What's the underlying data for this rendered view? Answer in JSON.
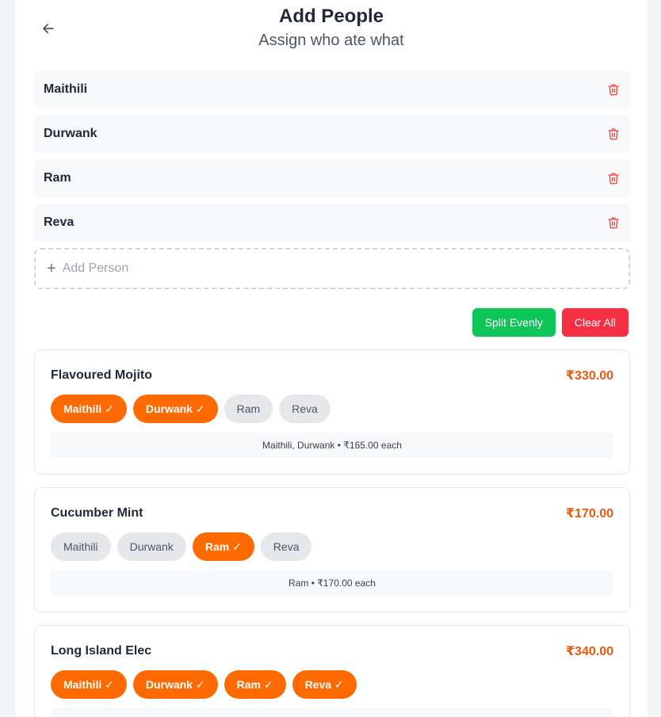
{
  "header": {
    "title": "Add People",
    "subtitle": "Assign who ate what",
    "back_icon": "arrow-left-icon"
  },
  "people": [
    {
      "name": "Maithili"
    },
    {
      "name": "Durwank"
    },
    {
      "name": "Ram"
    },
    {
      "name": "Reva"
    }
  ],
  "add_person": {
    "placeholder": "Add Person",
    "icon": "plus-icon"
  },
  "actions": {
    "split_label": "Split Evenly",
    "clear_label": "Clear All"
  },
  "items": [
    {
      "name": "Flavoured Mojito",
      "price": "₹330.00",
      "chips": [
        {
          "label": "Maithili ✓",
          "selected": true
        },
        {
          "label": "Durwank ✓",
          "selected": true
        },
        {
          "label": "Ram",
          "selected": false
        },
        {
          "label": "Reva",
          "selected": false
        }
      ],
      "summary": "Maithili, Durwank • ₹165.00 each"
    },
    {
      "name": "Cucumber Mint",
      "price": "₹170.00",
      "chips": [
        {
          "label": "Maithili",
          "selected": false
        },
        {
          "label": "Durwank",
          "selected": false
        },
        {
          "label": "Ram ✓",
          "selected": true
        },
        {
          "label": "Reva",
          "selected": false
        }
      ],
      "summary": "Ram • ₹170.00 each"
    },
    {
      "name": "Long Island Elec",
      "price": "₹340.00",
      "chips": [
        {
          "label": "Maithili ✓",
          "selected": true
        },
        {
          "label": "Durwank ✓",
          "selected": true
        },
        {
          "label": "Ram ✓",
          "selected": true
        },
        {
          "label": "Reva ✓",
          "selected": true
        }
      ]
    }
  ],
  "colors": {
    "accent_orange": "#ff6a00",
    "price_orange": "#ea580c",
    "split_green": "#0ec55a",
    "clear_red": "#f43042",
    "delete_red": "#ef4444"
  }
}
